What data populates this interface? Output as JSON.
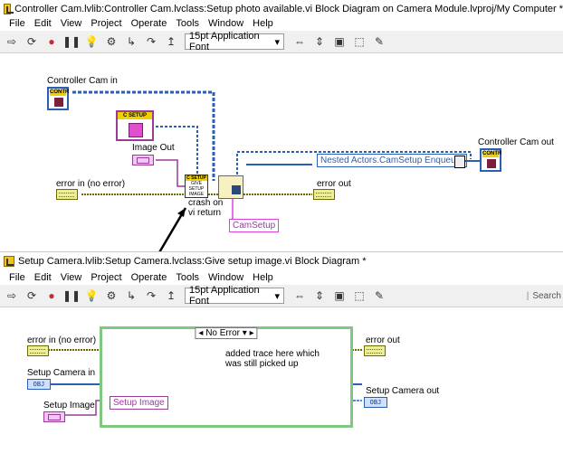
{
  "window1": {
    "title": "Controller Cam.lvlib:Controller Cam.lvclass:Setup photo available.vi Block Diagram on Camera Module.lvproj/My Computer *",
    "menu": [
      "File",
      "Edit",
      "View",
      "Project",
      "Operate",
      "Tools",
      "Window",
      "Help"
    ],
    "font": "15pt Application Font",
    "labels": {
      "controller_cam_in": "Controller Cam in",
      "image_out": "Image Out",
      "error_in": "error in (no error)",
      "error_out": "error out",
      "controller_cam_out": "Controller Cam out",
      "nested": "Nested Actors.CamSetup Enqueuer",
      "camsetup": "CamSetup",
      "annotation": "crash on\nvi return",
      "csetup": "C SETUP",
      "give_setup": "GIVE SETUP IMAGE",
      "contr": "CONTR",
      "obj": "OBJ"
    }
  },
  "window2": {
    "title": "Setup Camera.lvlib:Setup Camera.lvclass:Give setup image.vi Block Diagram *",
    "menu": [
      "File",
      "Edit",
      "View",
      "Project",
      "Operate",
      "Tools",
      "Window",
      "Help"
    ],
    "font": "15pt Application Font",
    "search": "Search",
    "labels": {
      "error_in": "error in (no error)",
      "error_out": "error out",
      "setup_camera_in": "Setup Camera in",
      "setup_image": "Setup Image",
      "setup_camera_out": "Setup Camera out",
      "case_selector": "No Error",
      "setup_image_box": "Setup Image",
      "comment": "added trace here which\nwas still picked up",
      "obj": "OBJ"
    }
  }
}
